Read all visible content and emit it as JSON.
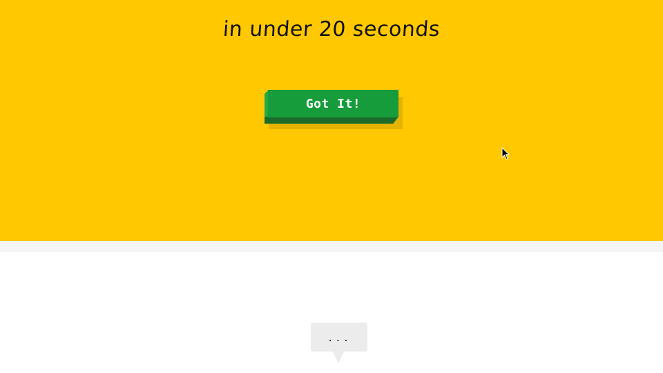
{
  "hero": {
    "headline": "in under 20 seconds",
    "background_color": "#ffc800"
  },
  "cta": {
    "label": "Got It!",
    "color": "#169c3a"
  },
  "chat": {
    "typing_indicator": "..."
  },
  "cursor": {
    "icon": "mouse-pointer-icon"
  }
}
